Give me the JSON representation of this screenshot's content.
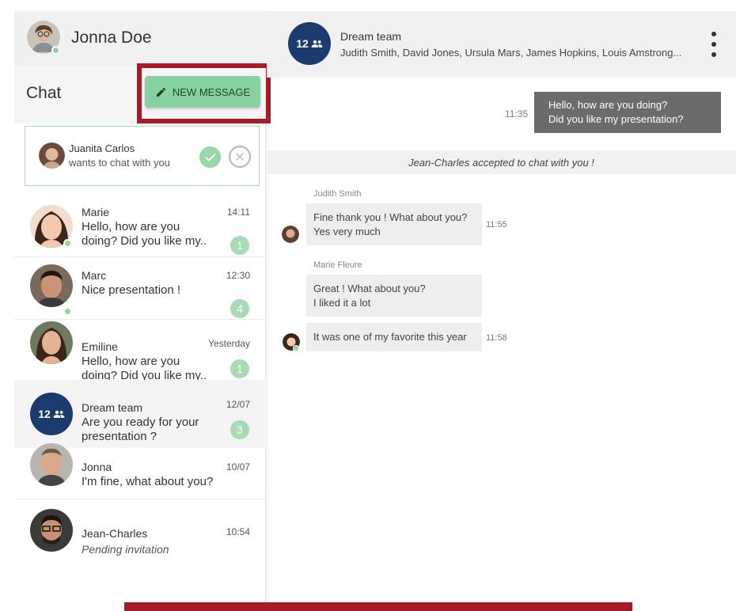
{
  "user": {
    "name": "Jonna Doe"
  },
  "sidebar": {
    "chat_title": "Chat",
    "new_message_label": "NEW MESSAGE"
  },
  "invite": {
    "name": "Juanita Carlos",
    "subtitle": "wants to chat with you"
  },
  "conversations": [
    {
      "name": "Marie",
      "time": "14:11",
      "preview_line1": "Hello, how are you",
      "preview_line2": "doing? Did you like my..",
      "unread": "1"
    },
    {
      "name": "Marc",
      "time": "12:30",
      "preview_line1": "Nice presentation !",
      "preview_line2": "",
      "unread": "4"
    },
    {
      "name": "Emiline",
      "time": "Yesterday",
      "preview_line1": "Hello, how are you",
      "preview_line2": "doing? Did you like my..",
      "unread": "1"
    },
    {
      "name": "Dream team",
      "time": "12/07",
      "preview_line1": "Are you ready for your",
      "preview_line2": "presentation ?",
      "unread": "3",
      "member_count": "12"
    },
    {
      "name": "Jonna",
      "time": "10/07",
      "preview_line1": "I'm fine, what about you?",
      "preview_line2": ""
    },
    {
      "name": "Jean-Charles",
      "time": "10:54",
      "preview_line1": "Pending invitation",
      "preview_line2": ""
    }
  ],
  "main": {
    "title": "Dream team",
    "member_count": "12",
    "members": "Judith Smith, David Jones, Ursula Mars, James Hopkins, Louis Amstrong..."
  },
  "messages": {
    "outgoing": {
      "time": "11:35",
      "line1": "Hello, how are you doing?",
      "line2": "Did you like my presentation?"
    },
    "system": "Jean-Charles accepted to chat with you !",
    "incoming": [
      {
        "sender": "Judith Smith",
        "line1": "Fine thank you ! What about you?",
        "line2": "Yes very much",
        "time": "11:55"
      },
      {
        "sender": "Marie Fleure",
        "line1": "Great ! What about you?",
        "line2": "I liked it a lot",
        "time": ""
      },
      {
        "sender": "",
        "line1": "It was one of my favorite this year",
        "line2": "",
        "time": "11:58"
      }
    ]
  },
  "colors": {
    "accent_green": "#86d2a0",
    "badge_green": "#a7dbb6",
    "team_blue": "#1b3a6e",
    "highlight_red": "#a71a27",
    "outgoing_bubble": "#6b6b6b"
  }
}
